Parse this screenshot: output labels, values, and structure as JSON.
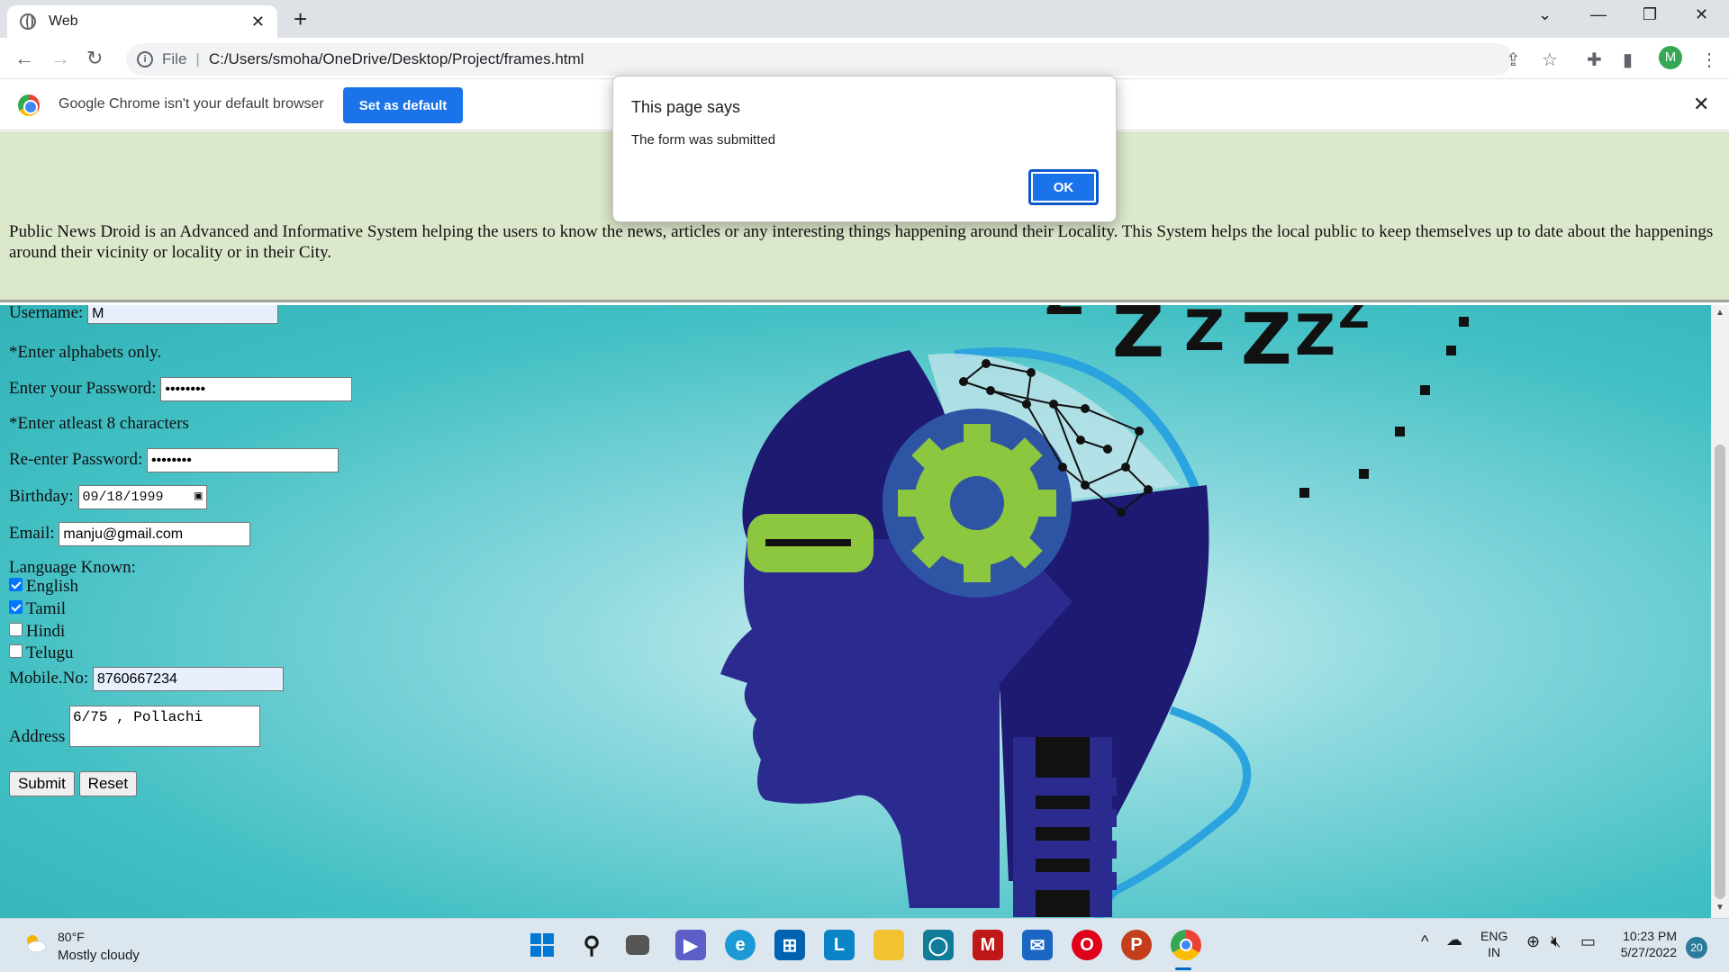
{
  "browser": {
    "tab_title": "Web",
    "address_scheme_label": "File",
    "address": "C:/Users/smoha/OneDrive/Desktop/Project/frames.html",
    "profile_initial": "M"
  },
  "infobar": {
    "message": "Google Chrome isn't your default browser",
    "button_label": "Set as default"
  },
  "dialog": {
    "title": "This page says",
    "message": "The form was submitted",
    "ok_label": "OK"
  },
  "page": {
    "about_text": "Public News Droid is an Advanced and Informative System helping the users to know the news, articles or any interesting things happening around their Locality. This System helps the local public to keep themselves up to date about the happenings around their vicinity or locality or in their City.",
    "form": {
      "username_label": "Username:",
      "username_value": "M",
      "username_hint": "*Enter alphabets only.",
      "password_label": "Enter your Password:",
      "password_value": "••••••••",
      "password_hint": "*Enter atleast 8 characters",
      "repassword_label": "Re-enter Password:",
      "repassword_value": "••••••••",
      "birthday_label": "Birthday:",
      "birthday_value": "09/18/1999",
      "email_label": "Email:",
      "email_value": "manju@gmail.com",
      "language_label": "Language Known:",
      "languages": [
        {
          "label": "English",
          "checked": true
        },
        {
          "label": "Tamil",
          "checked": true
        },
        {
          "label": "Hindi",
          "checked": false
        },
        {
          "label": "Telugu",
          "checked": false
        }
      ],
      "mobile_label": "Mobile.No:",
      "mobile_value": "8760667234",
      "address_label": "Address",
      "address_value": "6/75 , Pollachi",
      "submit_label": "Submit",
      "reset_label": "Reset"
    }
  },
  "taskbar": {
    "temperature": "80°F",
    "weather": "Mostly cloudy",
    "language_line1": "ENG",
    "language_line2": "IN",
    "time": "10:23 PM",
    "date": "5/27/2022",
    "notification_count": "20"
  },
  "colors": {
    "accent": "#1a73e8",
    "top_frame_bg": "#dce8cb",
    "bottom_frame_bg": "#43c0c4"
  }
}
